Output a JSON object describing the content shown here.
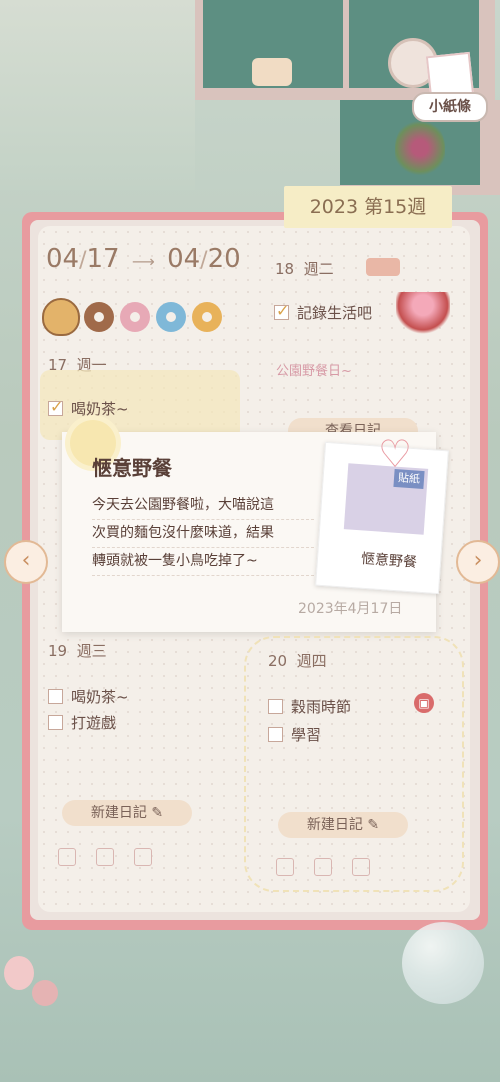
{
  "header": {
    "note_button": "小紙條",
    "week_tab": "2023 第15週"
  },
  "date_range": {
    "start_month": "04",
    "start_day": "17",
    "end_month": "04",
    "end_day": "20"
  },
  "days": [
    {
      "num": "17",
      "weekday": "週一",
      "tasks": [
        {
          "label": "喝奶茶~",
          "checked": true
        }
      ]
    },
    {
      "num": "18",
      "weekday": "週二",
      "tasks": [
        {
          "label": "記錄生活吧",
          "checked": true
        }
      ],
      "note": "公園野餐日~",
      "view_button": "查看日記"
    },
    {
      "num": "19",
      "weekday": "週三",
      "tasks": [
        {
          "label": "喝奶茶~",
          "checked": false
        },
        {
          "label": "打遊戲",
          "checked": false
        }
      ],
      "new_button": "新建日記"
    },
    {
      "num": "20",
      "weekday": "週四",
      "tasks": [
        {
          "label": "穀雨時節",
          "checked": false
        },
        {
          "label": "學習",
          "checked": false
        }
      ],
      "new_button": "新建日記"
    }
  ],
  "popup": {
    "title": "愜意野餐",
    "lines": [
      "今天去公園野餐啦，大喵說這",
      "次買的麵包沒什麼味道，結果",
      "轉頭就被一隻小鳥吃掉了~"
    ],
    "date": "2023年4月17日",
    "sticker_tag": "貼紙",
    "sticker_caption": "愜意野餐"
  },
  "nav": {
    "prev": "‹",
    "next": "›"
  },
  "colors": {
    "journal_border": "#e89b9f",
    "accent_pink": "#d79aa6",
    "tab": "#f6edc6"
  },
  "donut_colors": [
    "#a06a4a",
    "#e7a9b6",
    "#7fb8d8",
    "#e8b25a"
  ]
}
